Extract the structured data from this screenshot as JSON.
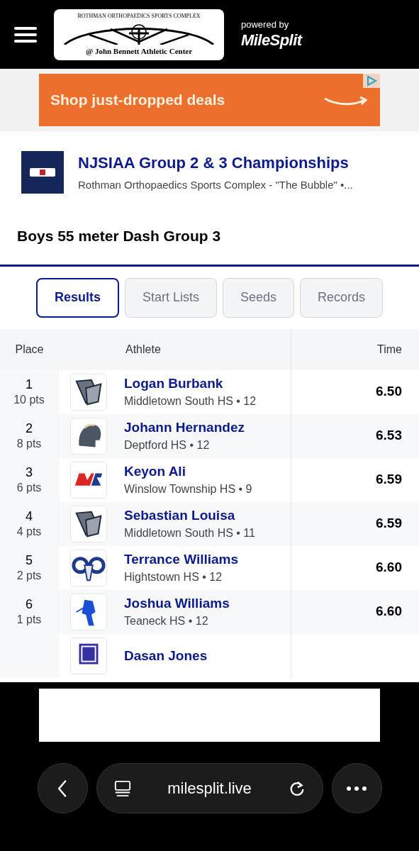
{
  "header": {
    "logo_arc_text": "ROTHMAN ORTHOPAEDICS SPORTS COMPLEX",
    "logo_subtext": "@ John Bennett Athletic Center",
    "powered_by": "powered by",
    "brand": "MileSplit"
  },
  "ad": {
    "text": "Shop just-dropped deals"
  },
  "meet": {
    "title": "NJSIAA Group 2 & 3 Championships",
    "venue": "Rothman Orthopaedics Sports Complex - \"The Bubble\" •..."
  },
  "event": {
    "title": "Boys 55 meter Dash Group 3"
  },
  "tabs": [
    {
      "label": "Results",
      "selected": true
    },
    {
      "label": "Start Lists",
      "selected": false
    },
    {
      "label": "Seeds",
      "selected": false
    },
    {
      "label": "Records",
      "selected": false
    }
  ],
  "table": {
    "columns": [
      "Place",
      "Athlete",
      "Time"
    ],
    "rows": [
      {
        "place": "1",
        "points": "10 pts",
        "kind": "wings",
        "name": "Logan Burbank",
        "team": "Middletown South HS • 12",
        "time": "6.50"
      },
      {
        "place": "2",
        "points": "8 pts",
        "kind": "helmet",
        "name": "Johann Hernandez",
        "team": "Deptford HS • 12",
        "time": "6.53"
      },
      {
        "place": "3",
        "points": "6 pts",
        "kind": "stripes",
        "name": "Keyon Ali",
        "team": "Winslow Township HS • 9",
        "time": "6.59"
      },
      {
        "place": "4",
        "points": "4 pts",
        "kind": "wings",
        "name": "Sebastian Louisa",
        "team": "Middletown South HS • 11",
        "time": "6.59"
      },
      {
        "place": "5",
        "points": "2 pts",
        "kind": "ram",
        "name": "Terrance Williams",
        "team": "Hightstown HS • 12",
        "time": "6.60"
      },
      {
        "place": "6",
        "points": "1 pts",
        "kind": "rider",
        "name": "Joshua Williams",
        "team": "Teaneck HS • 12",
        "time": "6.60"
      },
      {
        "kind": "block",
        "name": "Dasan Jones"
      }
    ]
  },
  "browser": {
    "url": "milesplit.live"
  }
}
